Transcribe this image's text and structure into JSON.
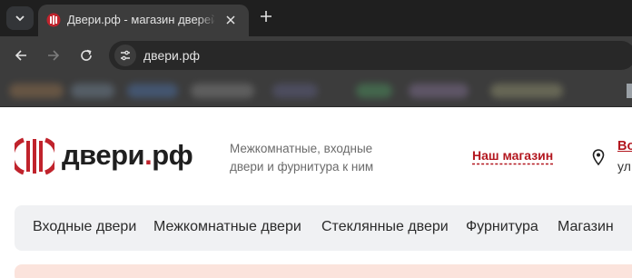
{
  "browser": {
    "tab": {
      "title": "Двери.рф - магазин дверей и фурнитуры"
    },
    "address_bar": {
      "url": "двери.рф"
    },
    "bookmark_colors": [
      "#8a6a4a",
      "#6a7a8a",
      "#4a6a9a",
      "#7a7a7a",
      "#5a5a7a",
      "#4a8a5a",
      "#7a6a8a",
      "#8a8a6a"
    ]
  },
  "site": {
    "logo": {
      "name": "двери",
      "dot": ".",
      "tld": "рф"
    },
    "tagline": "Межкомнатные, входные двери и фурнитура к ним",
    "store_link": "Наш магазин",
    "address": {
      "line1": "Во",
      "line2": "ул"
    },
    "menu": [
      "Входные двери",
      "Межкомнатные двери",
      "Стеклянные двери",
      "Фурнитура",
      "Магазин"
    ],
    "brand_color": "#c0232c"
  }
}
